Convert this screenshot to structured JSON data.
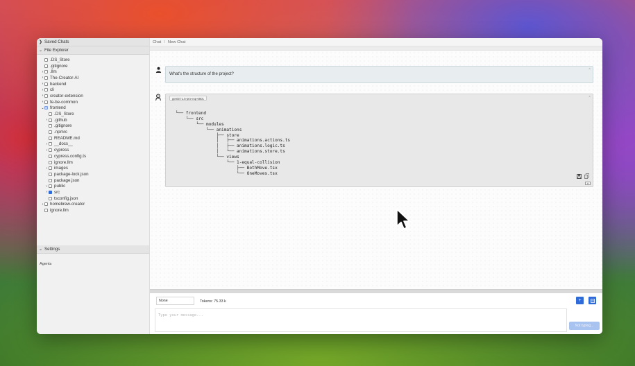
{
  "sidebar": {
    "saved_chats": "Saved Chats",
    "file_explorer": "File Explorer",
    "settings": "Settings",
    "agents": "Agents",
    "tree": [
      {
        "label": ".DS_Store",
        "indent": 0,
        "arrow": "",
        "state": "none"
      },
      {
        "label": ".gitignore",
        "indent": 0,
        "arrow": "",
        "state": "none"
      },
      {
        "label": ".llm",
        "indent": 0,
        "arrow": "›",
        "state": "none"
      },
      {
        "label": "The-Creator-AI",
        "indent": 0,
        "arrow": "›",
        "state": "none"
      },
      {
        "label": "backend",
        "indent": 0,
        "arrow": "›",
        "state": "none"
      },
      {
        "label": "cli",
        "indent": 0,
        "arrow": "›",
        "state": "none"
      },
      {
        "label": "creator-extension",
        "indent": 0,
        "arrow": "›",
        "state": "none"
      },
      {
        "label": "fe-be-common",
        "indent": 0,
        "arrow": "›",
        "state": "none"
      },
      {
        "label": "frontend",
        "indent": 0,
        "arrow": "⌄",
        "state": "partial"
      },
      {
        "label": ".DS_Store",
        "indent": 1,
        "arrow": "",
        "state": "none"
      },
      {
        "label": ".github",
        "indent": 1,
        "arrow": "›",
        "state": "none"
      },
      {
        "label": ".gitignore",
        "indent": 1,
        "arrow": "",
        "state": "none"
      },
      {
        "label": ".npmrc",
        "indent": 1,
        "arrow": "",
        "state": "none"
      },
      {
        "label": "README.md",
        "indent": 1,
        "arrow": "",
        "state": "none"
      },
      {
        "label": "__docs__",
        "indent": 1,
        "arrow": "›",
        "state": "none"
      },
      {
        "label": "cypress",
        "indent": 1,
        "arrow": "›",
        "state": "none"
      },
      {
        "label": "cypress.config.ts",
        "indent": 1,
        "arrow": "",
        "state": "none"
      },
      {
        "label": "ignore.llm",
        "indent": 1,
        "arrow": "",
        "state": "none"
      },
      {
        "label": "images",
        "indent": 1,
        "arrow": "›",
        "state": "none"
      },
      {
        "label": "package-lock.json",
        "indent": 1,
        "arrow": "",
        "state": "none"
      },
      {
        "label": "package.json",
        "indent": 1,
        "arrow": "",
        "state": "none"
      },
      {
        "label": "public",
        "indent": 1,
        "arrow": "›",
        "state": "none"
      },
      {
        "label": "src",
        "indent": 1,
        "arrow": "›",
        "state": "checked"
      },
      {
        "label": "tsconfig.json",
        "indent": 1,
        "arrow": "",
        "state": "none"
      },
      {
        "label": "homebrew-creator",
        "indent": 0,
        "arrow": "›",
        "state": "none"
      },
      {
        "label": "ignore.llm",
        "indent": 0,
        "arrow": "",
        "state": "none"
      }
    ]
  },
  "breadcrumb": {
    "root": "Chat",
    "separator": "/",
    "current": "New Chat"
  },
  "chat": {
    "user_message": "What's the structure of the project?",
    "model_tag": "gemini-1.5-pro-exp-0801",
    "code_lines": [
      "└── frontend",
      "    └── src",
      "        └── modules",
      "            └── animations",
      "                ├── store",
      "                │   ├── animations.actions.ts",
      "                │   ├── animations.logic.ts",
      "                │   └── animations.store.ts",
      "                └── views",
      "                    └── 1-equal-collision",
      "                        ├── BothMove.tsx",
      "                        └── OneMoves.tsx"
    ]
  },
  "input": {
    "model_value": "None",
    "tokens": "Tokens: 75.33 k",
    "placeholder": "Type your message...",
    "send_label": "Not typing..."
  },
  "colors": {
    "accent": "#2f6bd8",
    "send_disabled": "#a9c3f0"
  }
}
